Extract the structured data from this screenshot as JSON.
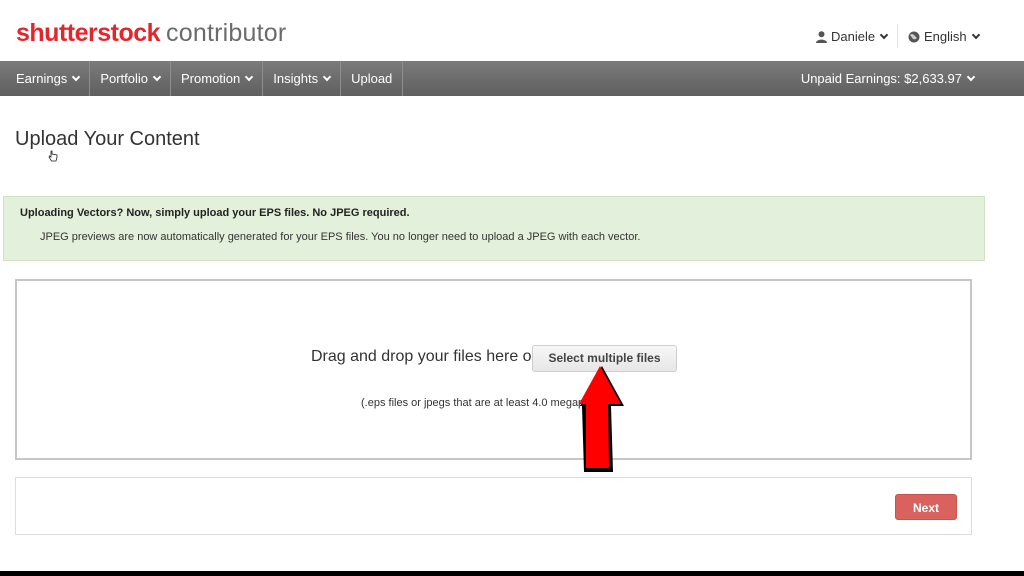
{
  "header": {
    "logo_brand": "shutterstock",
    "logo_sub": "contributor",
    "user_name": "Daniele",
    "language": "English",
    "user_icon": "user-icon",
    "globe_icon": "globe-icon"
  },
  "nav": {
    "items": [
      {
        "label": "Earnings"
      },
      {
        "label": "Portfolio"
      },
      {
        "label": "Promotion"
      },
      {
        "label": "Insights"
      },
      {
        "label": "Upload"
      }
    ],
    "unpaid_earnings": "Unpaid Earnings: $2,633.97"
  },
  "page": {
    "title": "Upload Your Content"
  },
  "alert": {
    "title": "Uploading Vectors? Now, simply upload your EPS files. No JPEG required.",
    "text": "JPEG previews are now automatically generated for your EPS files. You no longer need to upload a JPEG with each vector."
  },
  "dropzone": {
    "prompt": "Drag and drop your files here or",
    "button_label": "Select multiple files",
    "note": "(.eps files or jpegs that are at least 4.0 megapixels)"
  },
  "footer": {
    "next_label": "Next"
  },
  "colors": {
    "brand": "#e4262c",
    "nav_bg": "#6b6b6b",
    "alert_bg": "#e3f0dc",
    "next_button": "#d9625f",
    "annotation_arrow": "#ff0000"
  }
}
